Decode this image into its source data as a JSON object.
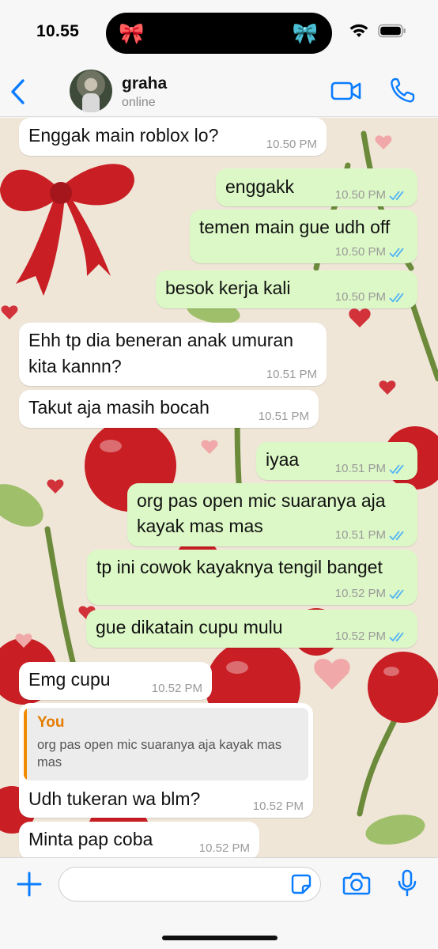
{
  "status_bar": {
    "time": "10.55",
    "left_decoration": "🎀",
    "right_decoration": "🎀",
    "right_decoration_color": "#bfe3ff"
  },
  "header": {
    "back_icon": "chevron-left-icon",
    "contact_name": "graha",
    "contact_status": "online",
    "accent": "#0a7cff"
  },
  "messages": [
    {
      "direction": "in",
      "text": "Enggak main roblox lo?",
      "time": "10.50 PM"
    },
    {
      "direction": "out",
      "text": "enggakk",
      "time": "10.50 PM",
      "read": true
    },
    {
      "direction": "out",
      "text": "temen main gue udh off",
      "time": "10.50 PM",
      "read": true
    },
    {
      "direction": "out",
      "text": "besok kerja kali",
      "time": "10.50 PM",
      "read": true
    },
    {
      "direction": "in",
      "text_lines": [
        "Ehh tp dia beneran anak umuran",
        "kita kannn?"
      ],
      "time": "10.51 PM"
    },
    {
      "direction": "in",
      "text": "Takut aja masih bocah",
      "time": "10.51 PM"
    },
    {
      "direction": "out",
      "text": "iyaa",
      "time": "10.51 PM",
      "read": true
    },
    {
      "direction": "out",
      "text_lines": [
        "org pas open mic suaranya aja",
        "kayak mas mas"
      ],
      "time": "10.51 PM",
      "read": true
    },
    {
      "direction": "out",
      "text": "tp ini cowok kayaknya tengil banget",
      "time": "10.52 PM",
      "read": true
    },
    {
      "direction": "out",
      "text": "gue dikatain cupu mulu",
      "time": "10.52 PM",
      "read": true
    },
    {
      "direction": "in",
      "text": "Emg cupu",
      "time": "10.52 PM"
    },
    {
      "direction": "in",
      "text": "Udh tukeran wa blm?",
      "time": "10.52 PM",
      "reply": {
        "author": "You",
        "text": "org pas open mic suaranya aja kayak mas mas"
      }
    },
    {
      "direction": "in",
      "text": "Minta pap coba",
      "time": "10.52 PM"
    }
  ],
  "colors": {
    "incoming_bubble": "#ffffff",
    "outgoing_bubble": "#dcf8c6",
    "read_tick": "#4fb3f6",
    "reply_accent": "#f08a00"
  },
  "input_bar": {
    "placeholder": ""
  }
}
